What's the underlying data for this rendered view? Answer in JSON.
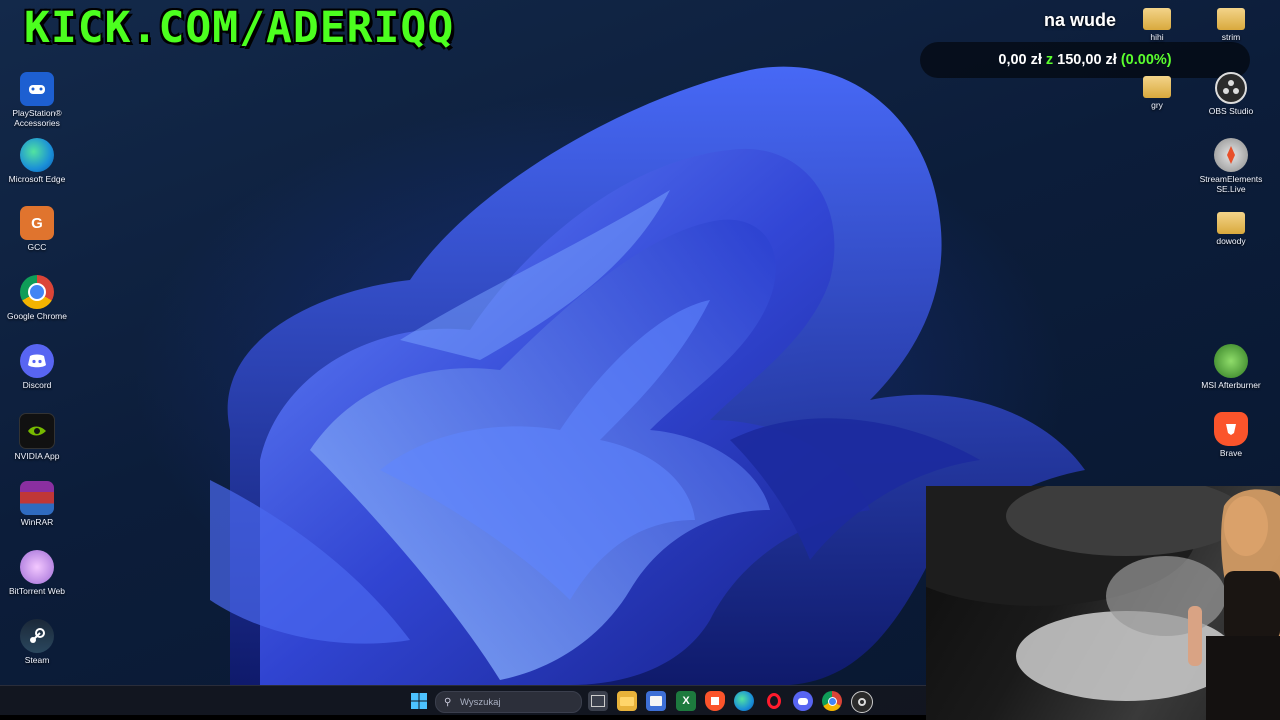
{
  "overlay": {
    "banner_text": "KICK.COM/ADERIQQ",
    "goal_title": "na wude",
    "goal_current": "0,00 zł",
    "goal_separator": "z",
    "goal_target": "150,00 zł",
    "goal_percent": "(0.00%)",
    "goal_progress_fraction": 0
  },
  "desktop": {
    "left_icons": [
      {
        "label": "PlayStation® Accessories",
        "icon": "playstation-icon"
      },
      {
        "label": "Microsoft Edge",
        "icon": "edge-icon"
      },
      {
        "label": "GCC",
        "icon": "gcc-icon"
      },
      {
        "label": "Google Chrome",
        "icon": "chrome-icon"
      },
      {
        "label": "Discord",
        "icon": "discord-icon"
      },
      {
        "label": "NVIDIA App",
        "icon": "nvidia-icon"
      },
      {
        "label": "WinRAR",
        "icon": "winrar-icon"
      },
      {
        "label": "BitTorrent Web",
        "icon": "bittorrent-icon"
      },
      {
        "label": "Steam",
        "icon": "steam-icon"
      }
    ],
    "right_icons": [
      {
        "label": "hihi",
        "icon": "folder-icon"
      },
      {
        "label": "strim",
        "icon": "folder-icon"
      },
      {
        "label": "gry",
        "icon": "folder-icon"
      },
      {
        "label": "OBS Studio",
        "icon": "obs-icon"
      },
      {
        "label": "StreamElements SE.Live",
        "icon": "streamelements-icon"
      },
      {
        "label": "dowody",
        "icon": "folder-icon"
      },
      {
        "label": "MSI Afterburner",
        "icon": "msi-afterburner-icon"
      },
      {
        "label": "Brave",
        "icon": "brave-icon"
      }
    ]
  },
  "taskbar": {
    "search_placeholder": "Wyszukaj",
    "apps": [
      "start-icon",
      "task-view-icon",
      "file-explorer-icon",
      "store-icon",
      "excel-icon",
      "brave-icon",
      "edge-icon",
      "opera-icon",
      "discord-icon",
      "chrome-icon",
      "obs-icon"
    ]
  },
  "colors": {
    "banner_green": "#4cff1f",
    "goal_green": "#5bff2e",
    "bloom_blue": "#3b5ee8"
  }
}
